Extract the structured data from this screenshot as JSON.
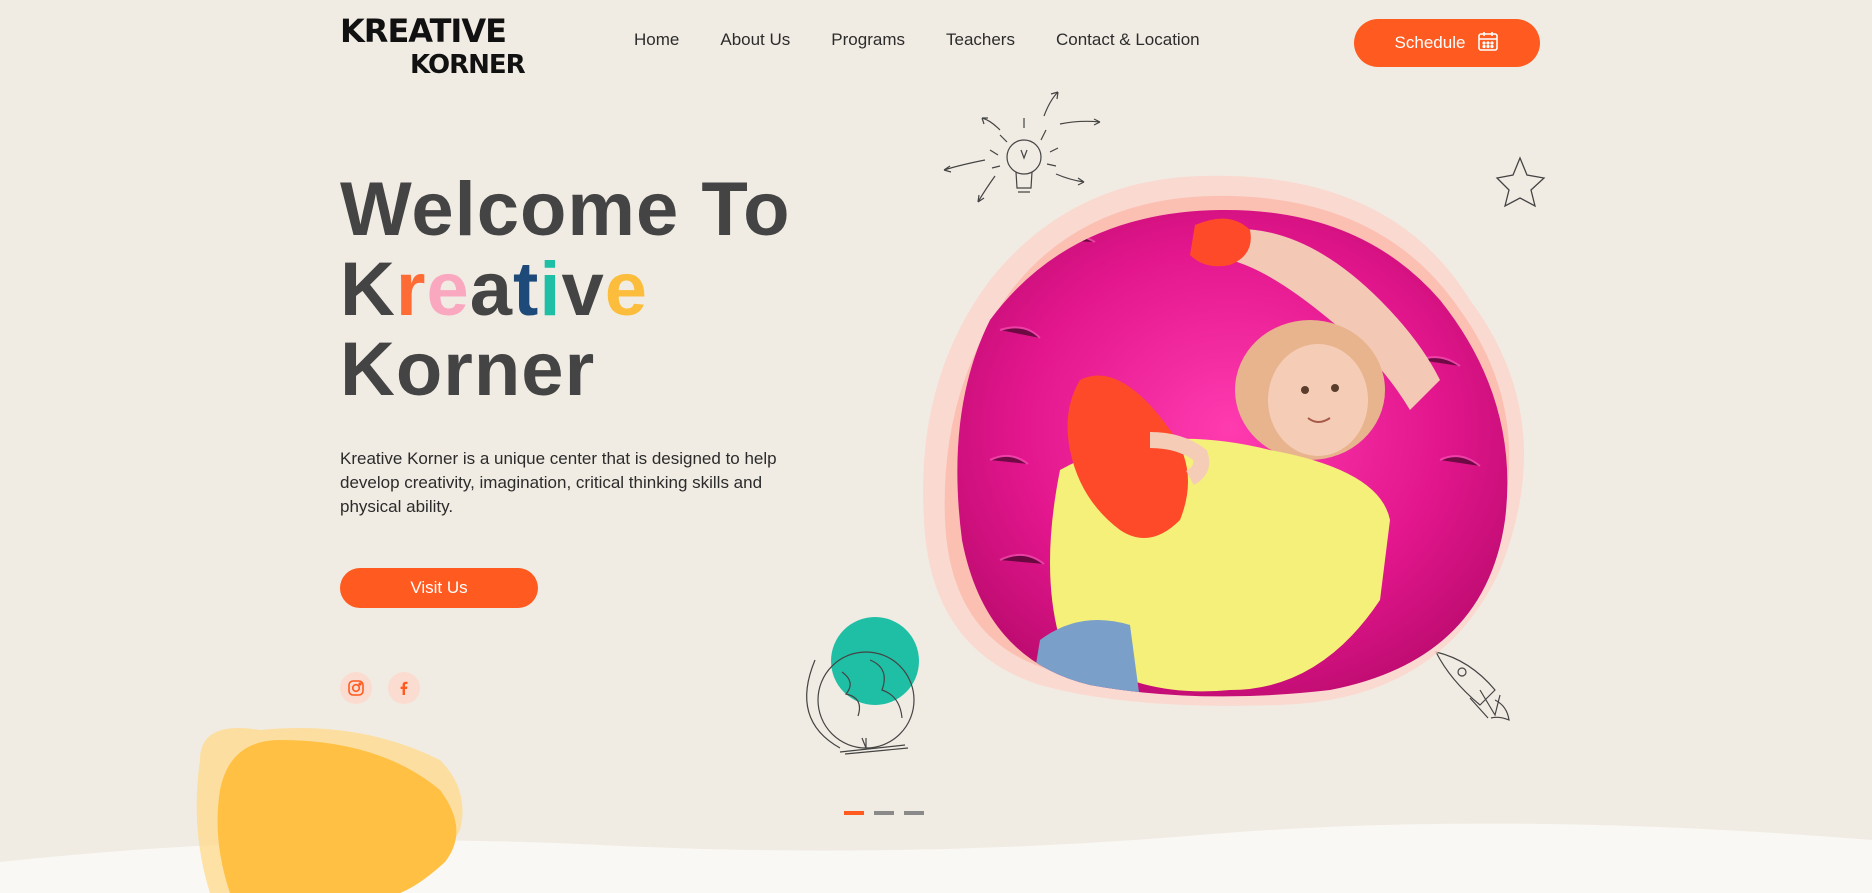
{
  "logo": {
    "line1": "KREATIVE",
    "line2": "KORNER"
  },
  "nav": {
    "items": [
      "Home",
      "About Us",
      "Programs",
      "Teachers",
      "Contact & Location"
    ]
  },
  "header": {
    "schedule_label": "Schedule"
  },
  "hero": {
    "title_line1": "Welcome To",
    "title_word2_letters": [
      "K",
      "r",
      "e",
      "a",
      "t",
      "i",
      "v",
      "e"
    ],
    "title_line3": "Korner",
    "description": "Kreative Korner is a unique center that is designed to help develop creativity, imagination, critical thinking skills and physical ability.",
    "visit_label": "Visit Us"
  },
  "colors": {
    "accent": "#ff5a1f",
    "title_letters": [
      "#444444",
      "#ff6b35",
      "#f9a8c0",
      "#444444",
      "#1e4a7a",
      "#1fbfa6",
      "#444444",
      "#fbbd3b"
    ],
    "yellow_blob": "#ffc043",
    "teal_circle": "#1fbfa6",
    "photo_ring": "#fdc8bd"
  },
  "social": {
    "instagram": "instagram-icon",
    "facebook": "facebook-icon"
  },
  "slider": {
    "total": 3,
    "active": 1
  }
}
